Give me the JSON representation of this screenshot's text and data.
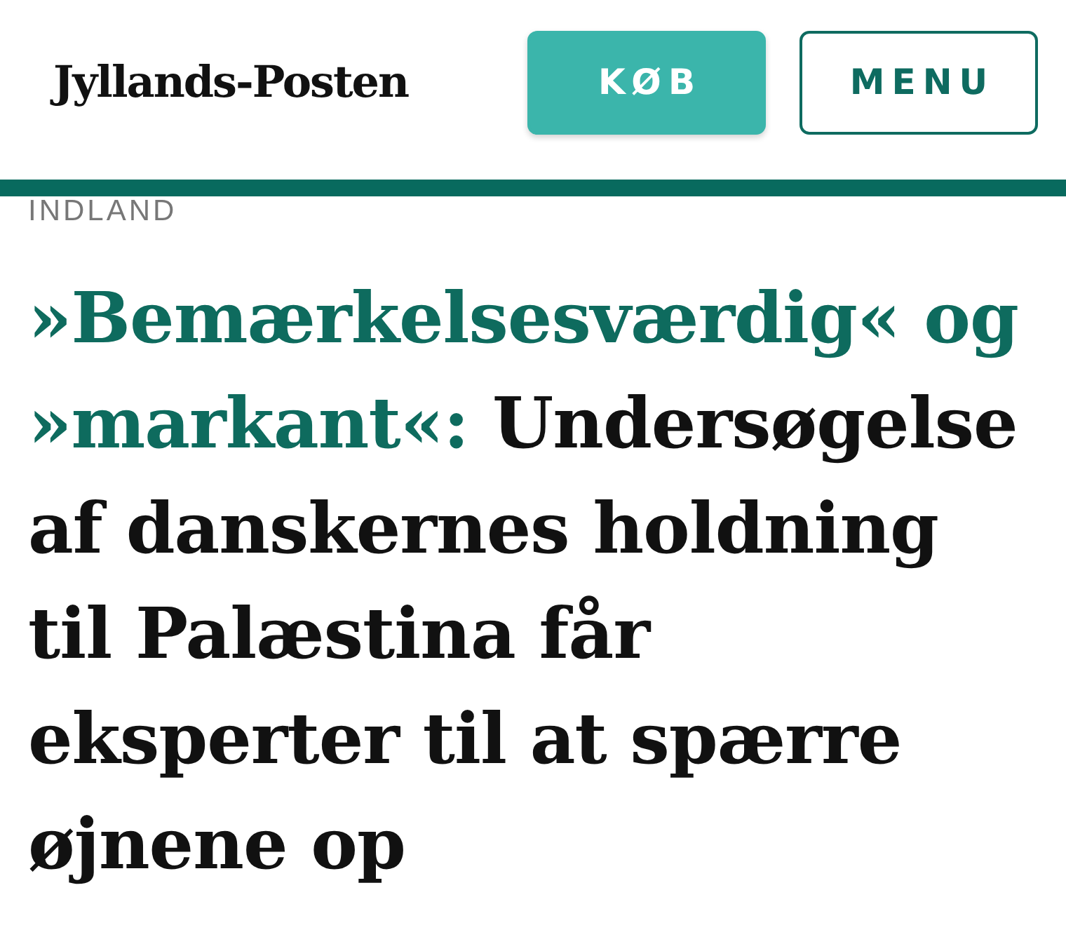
{
  "header": {
    "logo": "Jyllands-Posten",
    "buttons": [
      {
        "kind": "filled",
        "label": "KØB"
      },
      {
        "kind": "outline",
        "label": "MENU"
      }
    ]
  },
  "article": {
    "section": "INDLAND",
    "headline": {
      "kicker": "»Bemærkelsesværdig« og »markant«:",
      "title": "Undersøgelse af danskernes holdning til Palæstina får eksperter til at spærre øjnene op"
    }
  }
}
